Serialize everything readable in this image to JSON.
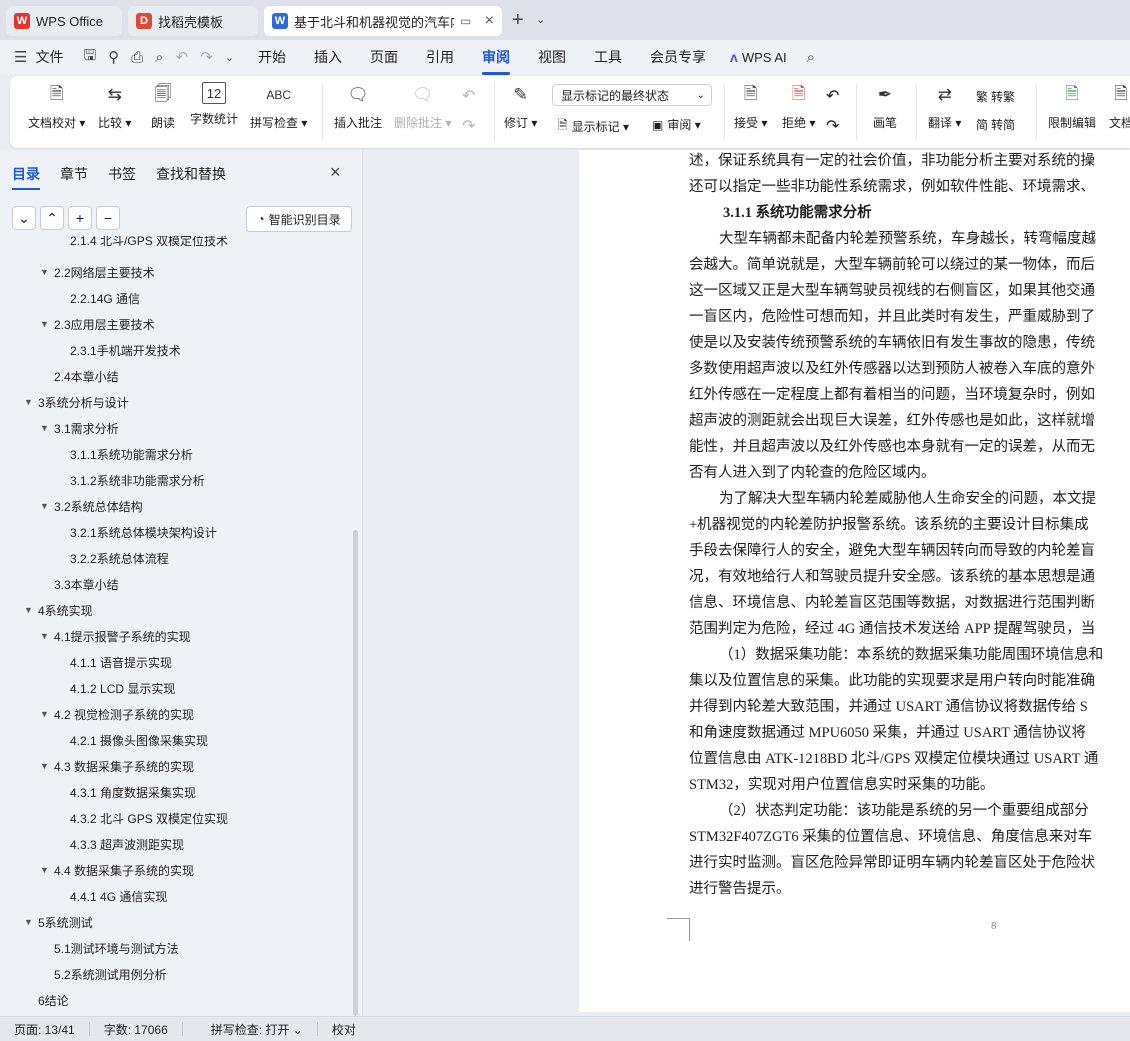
{
  "tabs": [
    {
      "label": "WPS Office"
    },
    {
      "label": "找稻壳模板"
    },
    {
      "label": "基于北斗和机器视觉的汽车内"
    }
  ],
  "menu": {
    "file": "文件",
    "items": [
      "开始",
      "插入",
      "页面",
      "引用",
      "审阅",
      "视图",
      "工具",
      "会员专享"
    ],
    "active": "审阅",
    "ai": "WPS AI"
  },
  "ribbon": {
    "doc_check": "文档校对",
    "compare": "比较",
    "read_aloud": "朗读",
    "word_count": "字数统计",
    "spell_check": "拼写检查",
    "insert_comment": "插入批注",
    "delete_comment": "删除批注",
    "revise": "修订",
    "markup_state": "显示标记的最终状态",
    "show_markup": "显示标记",
    "review": "审阅",
    "accept": "接受",
    "reject": "拒绝",
    "pen": "画笔",
    "translate": "翻译",
    "to_traditional": "转繁",
    "to_simplified": "转简",
    "restrict_edit": "限制编辑",
    "doc_perm": "文档"
  },
  "sidebar": {
    "tabs": [
      "目录",
      "章节",
      "书签",
      "查找和替换"
    ],
    "smart_toc": "智能识别目录",
    "toc": [
      {
        "label": "2.1.4  北斗/GPS 双模定位技术",
        "level": 3
      },
      {
        "label": "2.2网络层主要技术",
        "level": 2
      },
      {
        "label": "2.2.14G 通信",
        "level": 3
      },
      {
        "label": "2.3应用层主要技术",
        "level": 2
      },
      {
        "label": "2.3.1手机端开发技术",
        "level": 3
      },
      {
        "label": "2.4本章小结",
        "level": 2
      },
      {
        "label": "3系统分析与设计",
        "level": 1
      },
      {
        "label": "3.1需求分析",
        "level": 2
      },
      {
        "label": "3.1.1系统功能需求分析",
        "level": 3
      },
      {
        "label": "3.1.2系统非功能需求分析",
        "level": 3
      },
      {
        "label": "3.2系统总体结构",
        "level": 2
      },
      {
        "label": "3.2.1系统总体模块架构设计",
        "level": 3
      },
      {
        "label": "3.2.2系统总体流程",
        "level": 3
      },
      {
        "label": "3.3本章小结",
        "level": 2
      },
      {
        "label": "4系统实现",
        "level": 1
      },
      {
        "label": "4.1提示报警子系统的实现",
        "level": 2
      },
      {
        "label": "4.1.1 语音提示实现",
        "level": 3
      },
      {
        "label": "4.1.2    LCD 显示实现",
        "level": 3
      },
      {
        "label": "4.2 视觉检测子系统的实现",
        "level": 2
      },
      {
        "label": "4.2.1 摄像头图像采集实现",
        "level": 3
      },
      {
        "label": "4.3 数据采集子系统的实现",
        "level": 2
      },
      {
        "label": "4.3.1 角度数据采集实现",
        "level": 3
      },
      {
        "label": "4.3.2 北斗 GPS 双模定位实现",
        "level": 3
      },
      {
        "label": "4.3.3 超声波测距实现",
        "level": 3
      },
      {
        "label": "4.4 数据采集子系统的实现",
        "level": 2
      },
      {
        "label": "4.4.1 4G 通信实现",
        "level": 3
      },
      {
        "label": "5系统测试",
        "level": 1
      },
      {
        "label": "5.1测试环境与测试方法",
        "level": 2
      },
      {
        "label": "5.2系统测试用例分析",
        "level": 2
      },
      {
        "label": "6结论",
        "level": 1
      }
    ]
  },
  "document": {
    "lines": [
      "述，保证系统具有一定的社会价值，非功能分析主要对系统的操",
      "还可以指定一些非功能性系统需求，例如软件性能、环境需求、",
      "3.1.1  系统功能需求分析",
      "大型车辆都未配备内轮差预警系统，车身越长，转弯幅度越",
      "会越大。简单说就是，大型车辆前轮可以绕过的某一物体，而后",
      "这一区域又正是大型车辆驾驶员视线的右侧盲区，如果其他交通",
      "一盲区内，危险性可想而知，并且此类时有发生，严重威胁到了",
      "使是以及安装传统预警系统的车辆依旧有发生事故的隐患，传统",
      "多数使用超声波以及红外传感器以达到预防人被卷入车底的意外",
      "红外传感在一定程度上都有着相当的问题，当环境复杂时，例如",
      "超声波的测距就会出现巨大误差，红外传感也是如此，这样就增",
      "能性，并且超声波以及红外传感也本身就有一定的误差，从而无",
      "否有人进入到了内轮查的危险区域内。",
      "为了解决大型车辆内轮差威胁他人生命安全的问题，本文提",
      "+机器视觉的内轮差防护报警系统。该系统的主要设计目标集成",
      "手段去保障行人的安全，避免大型车辆因转向而导致的内轮差盲",
      "况，有效地给行人和驾驶员提升安全感。该系统的基本思想是通",
      "信息、环境信息、内轮差盲区范围等数据，对数据进行范围判断",
      "范围判定为危险，经过 4G 通信技术发送给 APP 提醒驾驶员，当",
      "（1）数据采集功能：本系统的数据采集功能周围环境信息和",
      "集以及位置信息的采集。此功能的实现要求是用户转向时能准确",
      "并得到内轮差大致范围，并通过 USART 通信协议将数据传给 S",
      "和角速度数据通过 MPU6050 采集，并通过 USART 通信协议将",
      "位置信息由 ATK-1218BD 北斗/GPS 双模定位模块通过 USART 通",
      "STM32，实现对用户位置信息实时采集的功能。",
      "（2）状态判定功能：该功能是系统的另一个重要组成部分",
      "STM32F407ZGT6 采集的位置信息、环境信息、角度信息来对车",
      "进行实时监测。盲区危险异常即证明车辆内轮差盲区处于危险状",
      "进行警告提示。"
    ],
    "page_number": "8"
  },
  "status": {
    "page": "页面: 13/41",
    "words": "字数: 17066",
    "spell": "拼写检查: 打开",
    "proof": "校对"
  },
  "colors": {
    "accent": "#1f5ad6",
    "wps_red": "#e8342b",
    "dao_red": "#e2473b",
    "w_blue": "#2f6bd8"
  }
}
